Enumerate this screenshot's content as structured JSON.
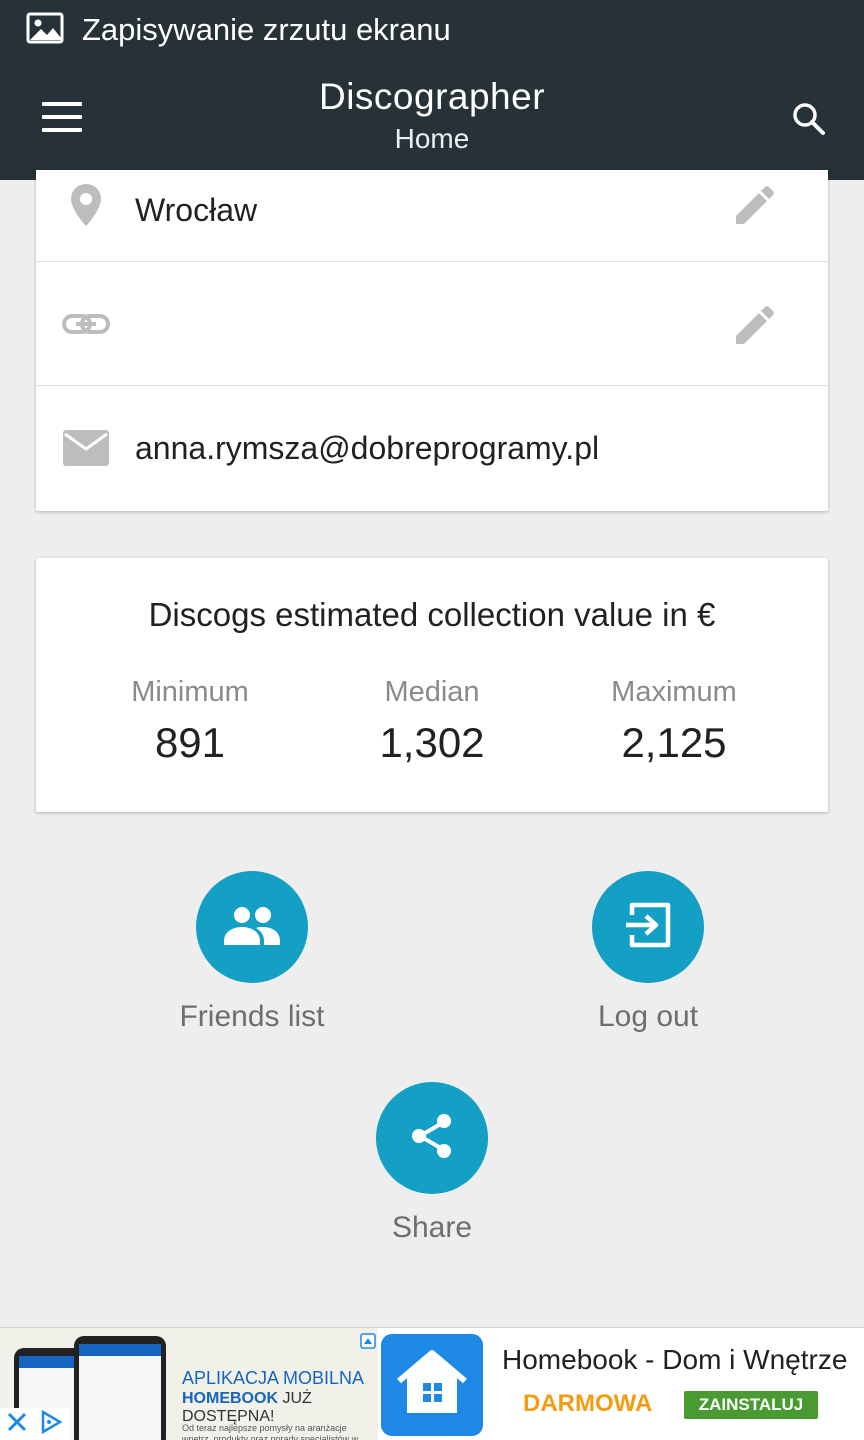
{
  "status_bar": {
    "text": "Zapisywanie zrzutu ekranu",
    "icon": "image-icon"
  },
  "app_bar": {
    "title": "Discographer",
    "subtitle": "Home",
    "menu_icon": "hamburger-menu-icon",
    "search_icon": "search-icon"
  },
  "profile": {
    "location": "Wrocław",
    "website": "",
    "email": "anna.rymsza@dobreprogramy.pl"
  },
  "collection_value": {
    "title": "Discogs estimated collection value in €",
    "stats": [
      {
        "label": "Minimum",
        "value": "891"
      },
      {
        "label": "Median",
        "value": "1,302"
      },
      {
        "label": "Maximum",
        "value": "2,125"
      }
    ]
  },
  "actions": {
    "friends_label": "Friends list",
    "logout_label": "Log out",
    "share_label": "Share"
  },
  "ad": {
    "headline": "APLIKACJA MOBILNA",
    "brand": "HOMEBOOK",
    "tagline": "JUŻ DOSTĘPNA!",
    "fine_print": "Od teraz najlepsze pomysły na aranżacje wnętrz, produkty oraz porady specjalistów w zasięgu ręki!",
    "app_name": "Homebook - Dom i Wnętrze",
    "price": "DARMOWA",
    "install_label": "ZAINSTALUJ"
  },
  "colors": {
    "app_bar": "#263238",
    "accent": "#14a0c4",
    "background": "#eeeeee",
    "install_button": "#4a9a32",
    "free_text": "#f39c12"
  }
}
